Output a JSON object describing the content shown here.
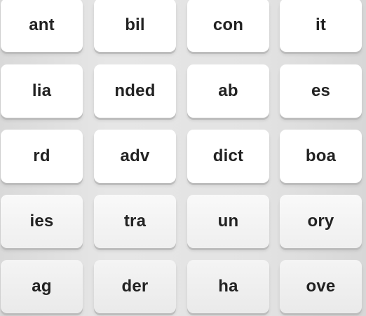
{
  "tiles": [
    [
      "ant",
      "bil",
      "con",
      "it"
    ],
    [
      "lia",
      "nded",
      "ab",
      "es"
    ],
    [
      "rd",
      "adv",
      "dict",
      "boa"
    ],
    [
      "ies",
      "tra",
      "un",
      "ory"
    ],
    [
      "ag",
      "der",
      "ha",
      "ove"
    ]
  ]
}
